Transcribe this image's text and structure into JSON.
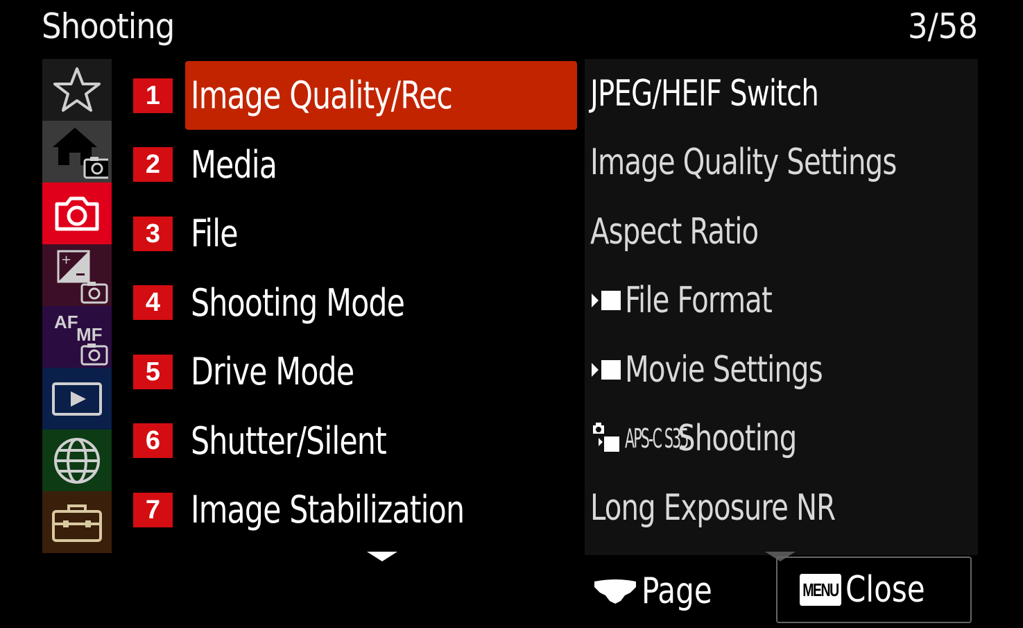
{
  "header": {
    "title": "Shooting",
    "page_counter": "3/58"
  },
  "tabs": [
    {
      "name": "my-menu",
      "icon": "star-icon",
      "bg": "#1a1a1a"
    },
    {
      "name": "main",
      "icon": "home-camera-icon",
      "bg": "#3a3a3a"
    },
    {
      "name": "shooting",
      "icon": "camera-icon",
      "bg": "#e0001b",
      "selected": true
    },
    {
      "name": "exposure-color",
      "icon": "exposure-camera-icon",
      "bg": "#3d0f26"
    },
    {
      "name": "focus",
      "icon": "af-mf-camera-icon",
      "bg": "#2b0c40",
      "text": {
        "af": "AF",
        "mf": "MF"
      }
    },
    {
      "name": "playback",
      "icon": "play-icon",
      "bg": "#0a1f4a"
    },
    {
      "name": "network",
      "icon": "globe-icon",
      "bg": "#0d3b14"
    },
    {
      "name": "setup",
      "icon": "toolbox-icon",
      "bg": "#3a1f0a"
    }
  ],
  "menu": {
    "items": [
      {
        "number": "1",
        "label": "Image Quality/Rec",
        "selected": true
      },
      {
        "number": "2",
        "label": "Media"
      },
      {
        "number": "3",
        "label": "File"
      },
      {
        "number": "4",
        "label": "Shooting Mode"
      },
      {
        "number": "5",
        "label": "Drive Mode"
      },
      {
        "number": "6",
        "label": "Shutter/Silent"
      },
      {
        "number": "7",
        "label": "Image Stabilization"
      }
    ]
  },
  "submenu": {
    "items": [
      {
        "label": "JPEG/HEIF Switch"
      },
      {
        "label": "Image Quality Settings"
      },
      {
        "label": "Aspect Ratio"
      },
      {
        "label": "File Format",
        "icon": "movie-icon"
      },
      {
        "label": "Movie Settings",
        "icon": "movie-icon"
      },
      {
        "label": "Shooting",
        "icon": "still-movie-icon",
        "prefix": "APS-C S35"
      },
      {
        "label": "Long Exposure NR"
      }
    ]
  },
  "footer": {
    "page_label": "Page",
    "menu_key": "MENU",
    "close_label": "Close"
  },
  "colors": {
    "accent_red": "#d40d12",
    "selected_bg": "#c22400",
    "tab_active": "#e0001b"
  }
}
